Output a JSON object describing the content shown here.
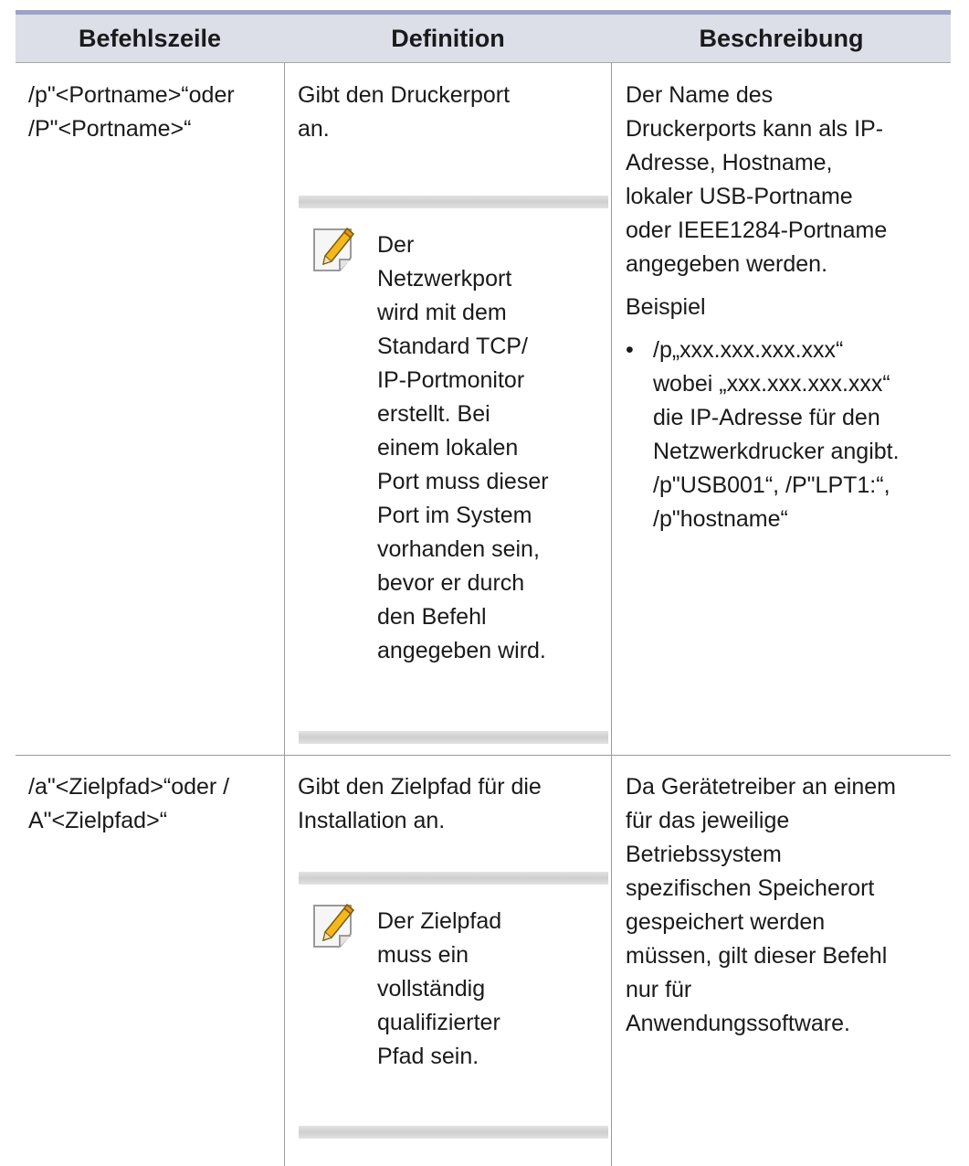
{
  "table": {
    "headers": [
      "Befehlszeile",
      "Definition",
      "Beschreibung"
    ],
    "rows": [
      {
        "command": [
          "/p\"<Portname>“oder",
          "/P\"<Portname>“"
        ],
        "definition": [
          "Gibt den Druckerport",
          "an."
        ],
        "note": {
          "icon": "note-pencil-icon",
          "lines": [
            "Der",
            "Netzwerkport",
            "wird mit dem",
            "Standard TCP/",
            "IP-Portmonitor",
            "erstellt. Bei",
            "einem lokalen",
            "Port muss dieser",
            "Port im System",
            "vorhanden sein,",
            "bevor er durch",
            "den Befehl",
            "angegeben wird."
          ]
        },
        "description": [
          "Der Name des",
          "Druckerports kann als IP-",
          "Adresse, Hostname,",
          "lokaler USB-Portname",
          "oder IEEE1284-Portname",
          "angegeben werden."
        ],
        "example_label": "Beispiel",
        "example_bullet": "•",
        "example_lines": [
          "/p„xxx.xxx.xxx.xxx“",
          "wobei „xxx.xxx.xxx.xxx“",
          "die IP-Adresse für den",
          "Netzwerkdrucker angibt.",
          "/p\"USB001“, /P\"LPT1:“,",
          "/p\"hostname“"
        ]
      },
      {
        "command": [
          "/a\"<Zielpfad>“oder /",
          "A\"<Zielpfad>“"
        ],
        "definition": [
          "Gibt den Zielpfad für die",
          "Installation an."
        ],
        "note": {
          "icon": "note-pencil-icon",
          "lines": [
            "Der Zielpfad",
            "muss ein",
            "vollständig",
            "qualifizierter",
            "Pfad sein."
          ]
        },
        "description": [
          "Da Gerätetreiber an einem",
          "für das jeweilige",
          "Betriebssystem",
          "spezifischen Speicherort",
          "gespeichert werden",
          "müssen, gilt dieser Befehl",
          "nur für",
          "Anwendungssoftware."
        ]
      }
    ]
  }
}
